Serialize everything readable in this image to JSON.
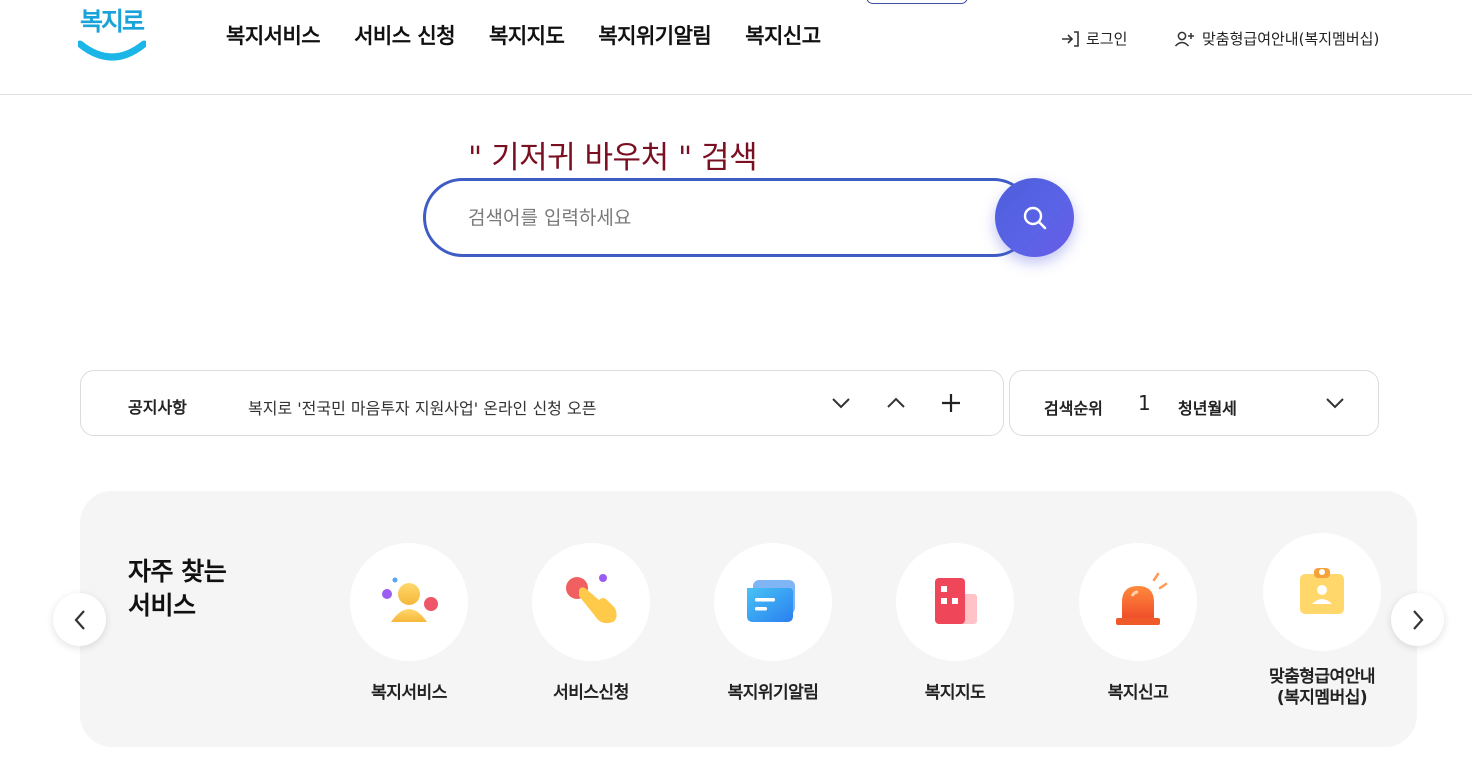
{
  "logo": {
    "text": "복지로"
  },
  "gnb": [
    {
      "label": "복지서비스"
    },
    {
      "label": "서비스 신청"
    },
    {
      "label": "복지지도"
    },
    {
      "label": "복지위기알림"
    },
    {
      "label": "복지신고"
    }
  ],
  "util": {
    "login": "로그인",
    "member": "맞춤형급여안내(복지멤버십)"
  },
  "search": {
    "title": "\" 기저귀 바우처 \" 검색",
    "placeholder": "검색어를 입력하세요"
  },
  "notice": {
    "label": "공지사항",
    "text": "복지로 '전국민 마음투자 지원사업' 온라인 신청 오픈"
  },
  "rank": {
    "label": "검색순위",
    "number": "1",
    "keyword": "청년월세"
  },
  "frequent": {
    "title_line1": "자주 찾는",
    "title_line2": "서비스",
    "items": [
      {
        "label": "복지서비스",
        "icon": "person-icon"
      },
      {
        "label": "서비스신청",
        "icon": "hand-pointer-icon"
      },
      {
        "label": "복지위기알림",
        "icon": "message-icon"
      },
      {
        "label": "복지지도",
        "icon": "building-icon"
      },
      {
        "label": "복지신고",
        "icon": "siren-icon"
      },
      {
        "label_line1": "맞춤형급여안내",
        "label_line2": "(복지멤버십)",
        "icon": "id-badge-icon"
      }
    ]
  },
  "colors": {
    "accent": "#3f5bc4",
    "title": "#7a0f22",
    "logo": "#1aa3d9"
  }
}
